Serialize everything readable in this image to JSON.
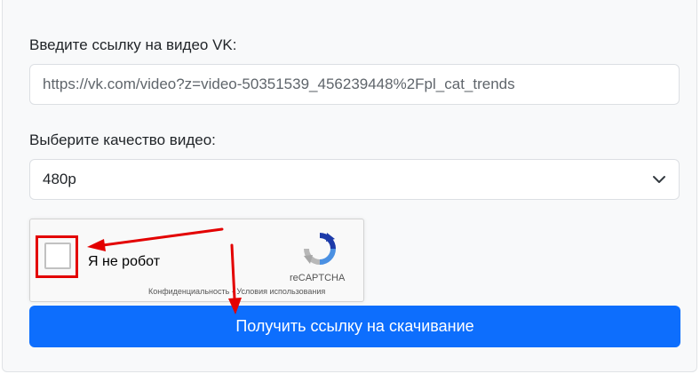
{
  "form": {
    "url_label": "Введите ссылку на видео VK:",
    "url_value": "https://vk.com/video?z=video-50351539_456239448%2Fpl_cat_trends",
    "quality_label": "Выберите качество видео:",
    "quality_value": "480p",
    "submit_label": "Получить ссылку на скачивание"
  },
  "recaptcha": {
    "checkbox_label": "Я не робот",
    "brand": "reCAPTCHA",
    "privacy_link": "Конфиденциальность",
    "separator": "-",
    "terms_link": "Условия использования"
  },
  "colors": {
    "accent": "#0d6efd",
    "annotation": "#e30000"
  },
  "icons": {
    "select_chevron": "chevron-down-icon",
    "recaptcha_logo": "recaptcha-logo-icon"
  }
}
